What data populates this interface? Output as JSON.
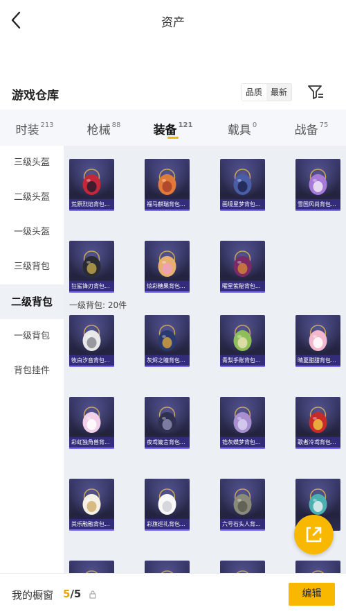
{
  "header": {
    "title": "资产"
  },
  "section": {
    "title": "游戏仓库",
    "sort_options": [
      {
        "label": "品质",
        "selected": true
      },
      {
        "label": "最新",
        "selected": false
      }
    ]
  },
  "tabs": [
    {
      "label": "时装",
      "count": "213",
      "active": false
    },
    {
      "label": "枪械",
      "count": "88",
      "active": false
    },
    {
      "label": "装备",
      "count": "121",
      "active": true
    },
    {
      "label": "载具",
      "count": "0",
      "active": false
    },
    {
      "label": "战备",
      "count": "75",
      "active": false
    }
  ],
  "sidebar": {
    "items": [
      {
        "label": "三级头盔",
        "active": false
      },
      {
        "label": "二级头盔",
        "active": false
      },
      {
        "label": "一级头盔",
        "active": false
      },
      {
        "label": "三级背包",
        "active": false
      },
      {
        "label": "二级背包",
        "active": true
      },
      {
        "label": "一级背包",
        "active": false
      },
      {
        "label": "背包挂件",
        "active": false
      }
    ]
  },
  "group_level2": {
    "items": [
      {
        "name": "荒原烈焰背包...",
        "icon": "backpack-red-flame"
      },
      {
        "name": "福马麒瑞背包...",
        "icon": "backpack-orange-horse"
      },
      {
        "name": "画境星梦背包...",
        "icon": "backpack-blue-painting"
      },
      {
        "name": "雪国风尚背包...",
        "icon": "backpack-purple-snow"
      },
      {
        "name": "狂鲨锋刃背包...",
        "icon": "backpack-black-shark"
      },
      {
        "name": "炫彩糖果背包...",
        "icon": "backpack-pink-candy"
      },
      {
        "name": "曜星紫秘背包...",
        "icon": "backpack-purple-star"
      }
    ]
  },
  "group_level1": {
    "header": "一级背包: 20件",
    "items": [
      {
        "name": "牧白汐音背包...",
        "icon": "backpack-white-shell"
      },
      {
        "name": "灰烬之瞳背包...",
        "icon": "backpack-blue-eye"
      },
      {
        "name": "青梨手账背包...",
        "icon": "backpack-green-pear"
      },
      {
        "name": "晴夏甜甜背包...",
        "icon": "backpack-pink-bunny"
      },
      {
        "name": "彩虹独角兽背...",
        "icon": "backpack-pink-unicorn"
      },
      {
        "name": "夜鸢箴言背包...",
        "icon": "backpack-dark-crow"
      },
      {
        "name": "锆灰蝶梦背包...",
        "icon": "backpack-lilac-butterfly"
      },
      {
        "name": "歌者冷鸢背包...",
        "icon": "backpack-red-pouch"
      },
      {
        "name": "其乐融融背包...",
        "icon": "backpack-white-bear"
      },
      {
        "name": "彩旗巡礼背包...",
        "icon": "backpack-white-rabbit"
      },
      {
        "name": "六号石头人背...",
        "icon": "backpack-gray-golem"
      },
      {
        "name": "",
        "icon": "backpack-teal-gem"
      },
      {
        "name": "",
        "icon": "backpack-partial-1"
      },
      {
        "name": "",
        "icon": "backpack-partial-2"
      },
      {
        "name": "",
        "icon": "backpack-partial-3"
      },
      {
        "name": "",
        "icon": "backpack-partial-4"
      }
    ]
  },
  "bottom_bar": {
    "label": "我的橱窗",
    "current": "5",
    "slash_total": "/5",
    "edit_label": "编辑"
  },
  "colors": {
    "accent": "#f9b800",
    "card_label": "#332c7a",
    "card_border": "#7b6cf0",
    "grid_bg": "#eceff3"
  }
}
